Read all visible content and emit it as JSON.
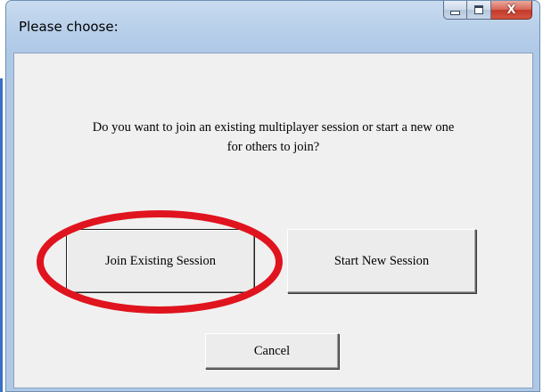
{
  "window": {
    "title": "Please choose:"
  },
  "caption_buttons": {
    "minimize_icon": "minimize-icon",
    "maximize_icon": "maximize-icon",
    "close_icon": "close-icon",
    "close_glyph": "X"
  },
  "dialog": {
    "message_line1": "Do you want to join an existing multiplayer session or start a new one",
    "message_line2": "for others to join?",
    "join_label": "Join Existing Session",
    "start_label": "Start New Session",
    "cancel_label": "Cancel"
  },
  "annotation": {
    "highlight_color": "#e0141e",
    "highlight_target": "Join Existing Session"
  },
  "colors": {
    "titlebar": "#b9d0ea",
    "client_bg": "#f0f0f0",
    "close_button": "#c23a2a"
  }
}
